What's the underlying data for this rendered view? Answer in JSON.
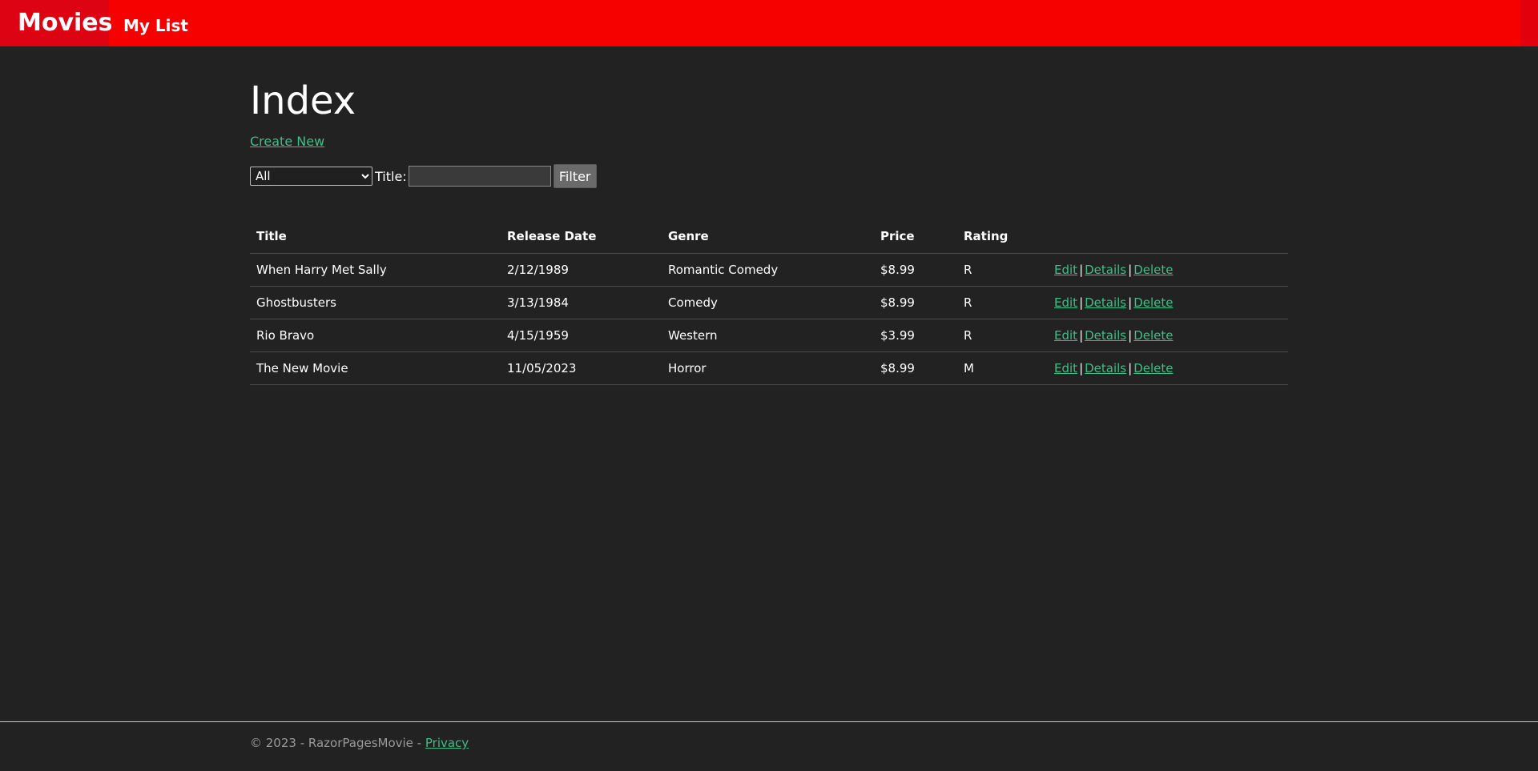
{
  "navbar": {
    "brand": "Movies",
    "link": "My List"
  },
  "page": {
    "title": "Index",
    "create_new": "Create New"
  },
  "filter": {
    "genre_selected": "All",
    "title_label": "Title:",
    "title_value": "",
    "button_label": "Filter"
  },
  "table": {
    "headers": [
      "Title",
      "Release Date",
      "Genre",
      "Price",
      "Rating"
    ],
    "rows": [
      {
        "title": "When Harry Met Sally",
        "release_date": "2/12/1989",
        "genre": "Romantic Comedy",
        "price": "$8.99",
        "rating": "R"
      },
      {
        "title": "Ghostbusters",
        "release_date": "3/13/1984",
        "genre": "Comedy",
        "price": "$8.99",
        "rating": "R"
      },
      {
        "title": "Rio Bravo",
        "release_date": "4/15/1959",
        "genre": "Western",
        "price": "$3.99",
        "rating": "R"
      },
      {
        "title": "The New Movie",
        "release_date": "11/05/2023",
        "genre": "Horror",
        "price": "$8.99",
        "rating": "M"
      }
    ],
    "actions": {
      "edit": "Edit",
      "details": "Details",
      "delete": "Delete",
      "separator": "|"
    }
  },
  "footer": {
    "text": "© 2023 - RazorPagesMovie - ",
    "privacy": "Privacy"
  },
  "colors": {
    "navbar": "#f60000",
    "brand_bg": "#de0313",
    "background": "#222222",
    "link": "#3dbf86",
    "footer_text": "#9a9a9a"
  }
}
